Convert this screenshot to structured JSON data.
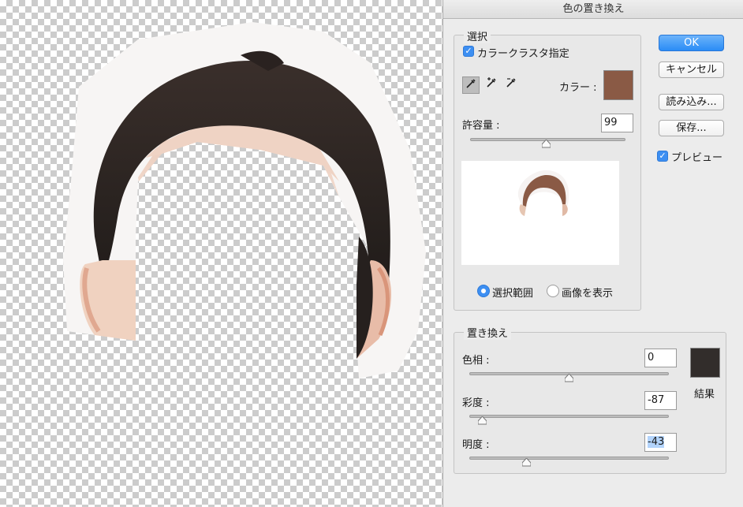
{
  "dialog": {
    "title": "色の置き換え",
    "selection": {
      "group_title": "選択",
      "color_cluster_label": "カラークラスタ指定",
      "color_cluster_checked": true,
      "color_label": "カラー :",
      "color_value": "#8a5a45",
      "tolerance_label": "許容量 :",
      "tolerance_value": "99",
      "tolerance_level": 0.49,
      "eyedropper_tools": [
        "eyedropper-icon",
        "eyedropper-plus-icon",
        "eyedropper-minus-icon"
      ],
      "view_option_selection": "選択範囲",
      "view_option_image": "画像を表示",
      "view_selected": "選択範囲"
    },
    "replacement": {
      "group_title": "置き換え",
      "hue_label": "色相 :",
      "hue_value": "0",
      "hue_level": 0.5,
      "saturation_label": "彩度 :",
      "saturation_value": "-87",
      "saturation_level": 0.065,
      "lightness_label": "明度 :",
      "lightness_value": "-43",
      "lightness_level": 0.285,
      "result_label": "結果",
      "result_color": "#322d2b"
    },
    "buttons": {
      "ok": "OK",
      "cancel": "キャンセル",
      "load": "読み込み...",
      "save": "保存..."
    },
    "preview_label": "プレビュー",
    "preview_checked": true,
    "accent_color": "#3d8ff2"
  }
}
